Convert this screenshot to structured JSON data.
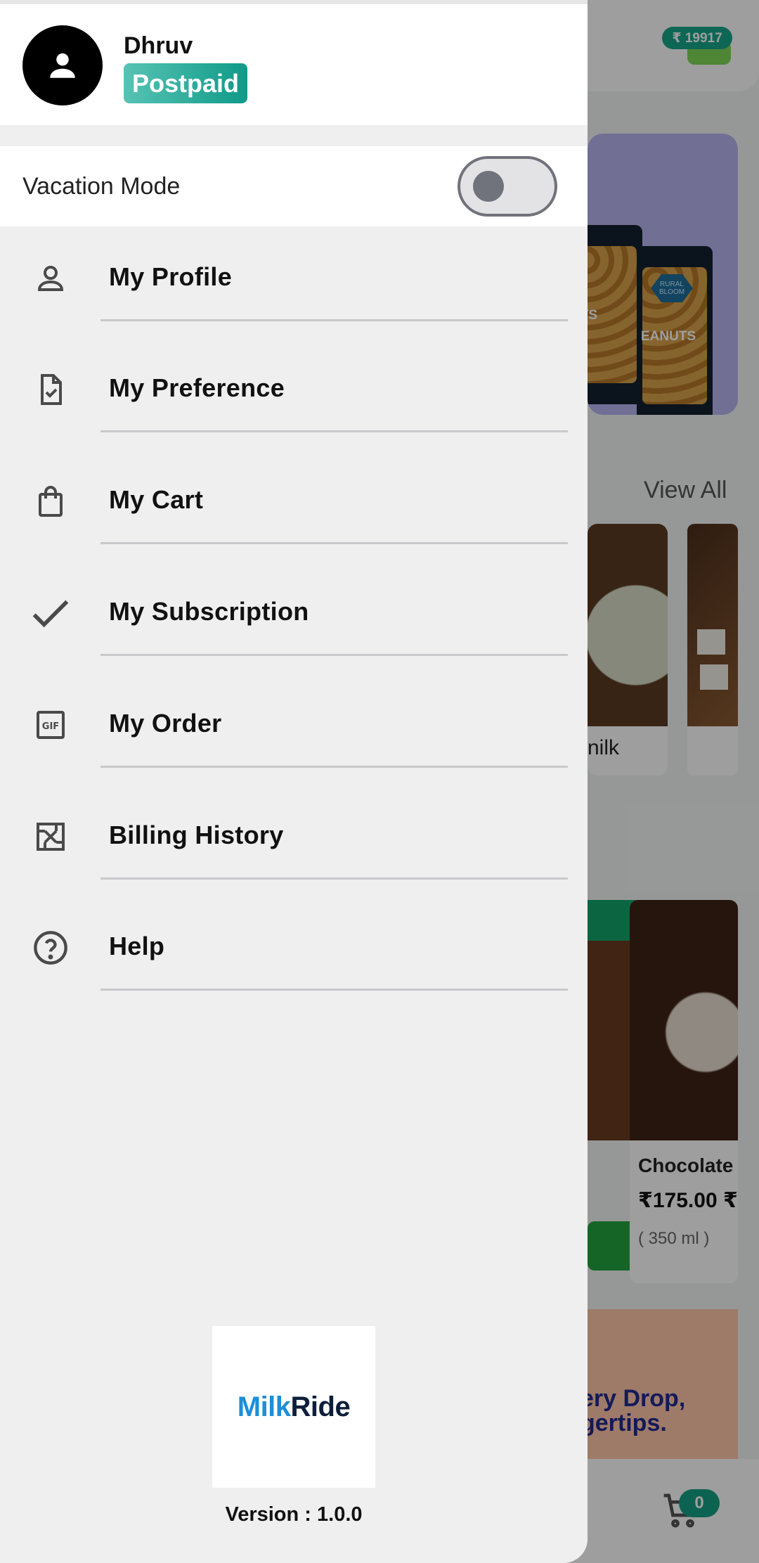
{
  "background": {
    "wallet_balance": "₹ 19917",
    "view_all": "View All",
    "card_partial_label": "nilk",
    "product_name": "Chocolate",
    "product_price": "₹175.00 ₹",
    "product_qty": "( 350 ml )",
    "promo_text": "ery Drop, gertips.",
    "pack_label_1": "UTS",
    "pack_label_2": "EANUTS",
    "pack_brand": "RURAL BLOOM",
    "cart_count": "0"
  },
  "drawer": {
    "user": {
      "name": "Dhruv",
      "plan": "Postpaid"
    },
    "vacation_mode": {
      "label": "Vacation Mode",
      "enabled": false
    },
    "menu": [
      {
        "label": "My Profile",
        "icon": "person-icon"
      },
      {
        "label": "My Preference",
        "icon": "document-check-icon"
      },
      {
        "label": "My Cart",
        "icon": "shopping-bag-icon"
      },
      {
        "label": "My Subscription",
        "icon": "checkmark-icon"
      },
      {
        "label": "My Order",
        "icon": "gif-box-icon"
      },
      {
        "label": "Billing History",
        "icon": "image-frame-icon"
      },
      {
        "label": "Help",
        "icon": "help-circle-icon"
      }
    ],
    "logo": {
      "part1": "Milk",
      "part2": "Ride"
    },
    "version": "Version : 1.0.0"
  },
  "colors": {
    "accent": "#17a589",
    "badge_gradient_start": "#57c3b4",
    "badge_gradient_end": "#0f9a88",
    "logo_blue": "#1c8fd8",
    "logo_navy": "#0d1f3a"
  }
}
